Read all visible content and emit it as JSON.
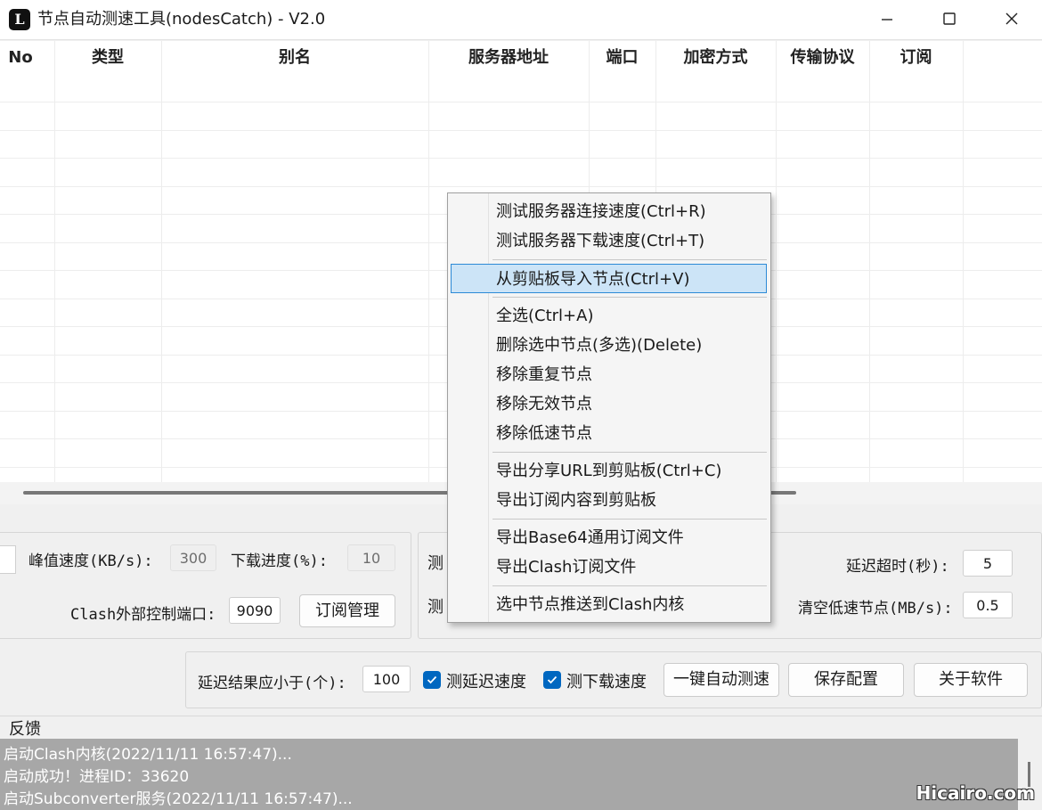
{
  "window": {
    "title": "节点自动测速工具(nodesCatch) - V2.0",
    "icon_letter": "L",
    "controls": [
      "minimize-icon",
      "maximize-icon",
      "close-icon"
    ]
  },
  "table": {
    "columns": [
      "No",
      "类型",
      "别名",
      "服务器地址",
      "端口",
      "加密方式",
      "传输协议",
      "订阅"
    ]
  },
  "panel_left": {
    "peak_speed_label": "峰值速度(KB/s):",
    "peak_speed_value": "300",
    "download_progress_label": "下载进度(%):",
    "download_progress_value": "10",
    "clash_port_label": "Clash外部控制端口:",
    "clash_port_value": "9090",
    "subscription_button": "订阅管理"
  },
  "panel_right": {
    "partial_label_1": "测",
    "partial_label_2": "测",
    "timeout_label": "延迟超时(秒):",
    "timeout_value": "5",
    "clear_slow_label": "清空低速节点(MB/s):",
    "clear_slow_value": "0.5"
  },
  "bottom_bar": {
    "latency_limit_label": "延迟结果应小于(个):",
    "latency_limit_value": "100",
    "check_latency_label": "测延迟速度",
    "check_latency_checked": true,
    "check_download_label": "测下载速度",
    "check_download_checked": true,
    "auto_test_button": "一键自动测速",
    "save_button": "保存配置",
    "about_button": "关于软件"
  },
  "feedback": {
    "label": "反馈",
    "lines": [
      "启动Clash内核(2022/11/11 16:57:47)...",
      "启动成功！进程ID：33620",
      "启动Subconverter服务(2022/11/11 16:57:47)..."
    ]
  },
  "watermark": "Hicairo.com",
  "context_menu": {
    "items": [
      {
        "label": "测试服务器连接速度(Ctrl+R)"
      },
      {
        "label": "测试服务器下载速度(Ctrl+T)"
      },
      {
        "label": "从剪贴板导入节点(Ctrl+V)",
        "highlighted": true
      },
      {
        "label": "全选(Ctrl+A)"
      },
      {
        "label": "删除选中节点(多选)(Delete)"
      },
      {
        "label": "移除重复节点"
      },
      {
        "label": "移除无效节点"
      },
      {
        "label": "移除低速节点"
      },
      {
        "label": "导出分享URL到剪贴板(Ctrl+C)"
      },
      {
        "label": "导出订阅内容到剪贴板"
      },
      {
        "label": "导出Base64通用订阅文件"
      },
      {
        "label": "导出Clash订阅文件"
      },
      {
        "label": "选中节点推送到Clash内核"
      }
    ]
  },
  "colors": {
    "accent": "#0067c0",
    "menu_highlight": "#cce4f7",
    "menu_highlight_border": "#2c8ad6",
    "log_background": "#a7a7a7"
  }
}
